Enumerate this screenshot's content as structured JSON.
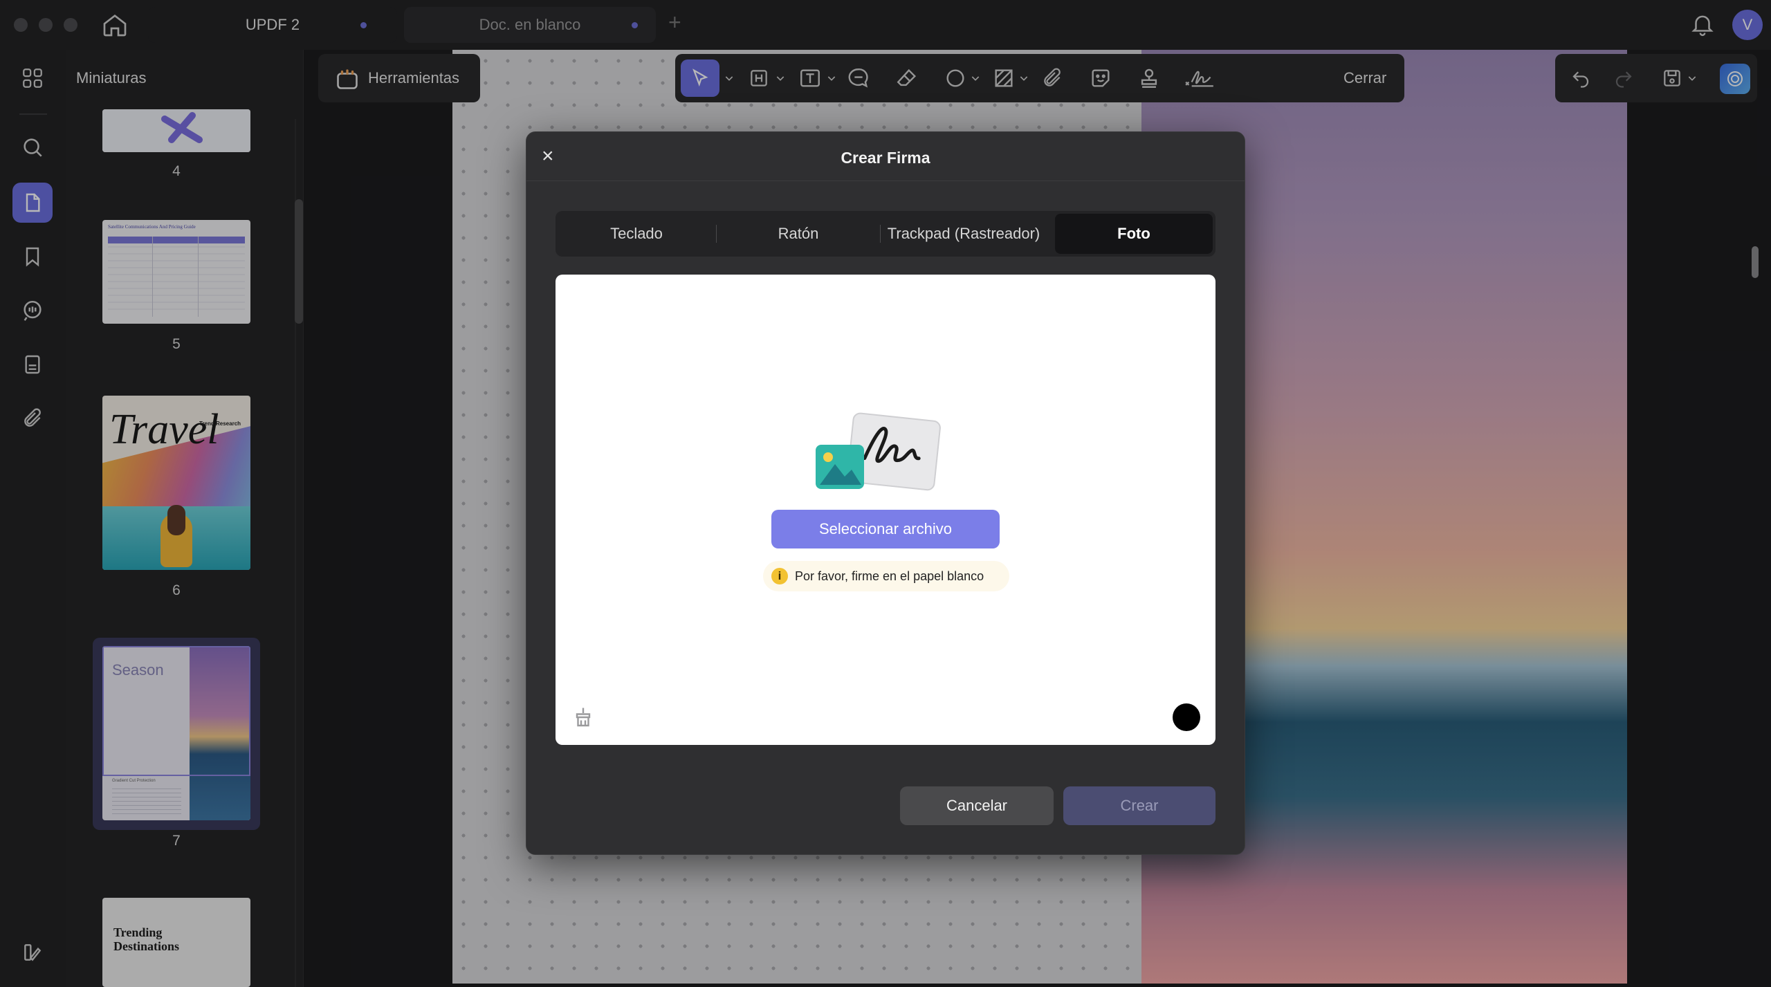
{
  "titlebar": {
    "home_tab": "UPDF 2",
    "doc_tab": "Doc. en blanco",
    "new_tab": "+"
  },
  "sidebar": {
    "title": "Miniaturas",
    "rail": [
      "apps-icon",
      "search-icon",
      "pages-icon",
      "bookmark-icon",
      "comments-icon",
      "form-icon",
      "attachment-icon"
    ]
  },
  "thumbnails": [
    {
      "page": "4"
    },
    {
      "page": "5",
      "heading": "Satellite Communications And Pricing Guide"
    },
    {
      "page": "6",
      "title": "Travel",
      "subtitle": "Trend Research"
    },
    {
      "page": "7",
      "title": "Season",
      "caption": "Gradient Cut Protection"
    },
    {
      "page": "",
      "title": "Trending Destinations"
    }
  ],
  "toolbar": {
    "tools_label": "Herramientas",
    "close_label": "Cerrar"
  },
  "avatar_letter": "V",
  "dialog": {
    "title": "Crear Firma",
    "close": "×",
    "tabs": [
      "Teclado",
      "Ratón",
      "Trackpad (Rastreador)",
      "Foto"
    ],
    "selected_tab": "Foto",
    "select_file": "Seleccionar archivo",
    "hint": "Por favor, firme en el papel blanco",
    "hint_icon": "i",
    "cancel": "Cancelar",
    "create": "Crear",
    "ink_color": "#000000"
  },
  "colors": {
    "accent": "#6b6fe0",
    "button_primary": "#7b7ee8",
    "create_disabled": "#4b4d72"
  }
}
